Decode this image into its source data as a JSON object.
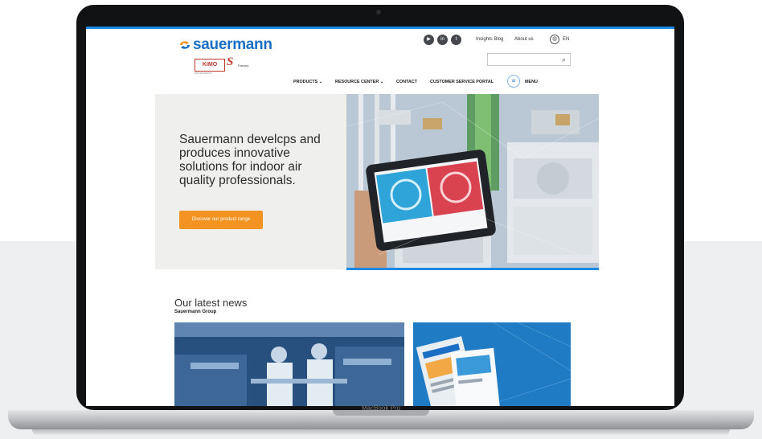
{
  "device": {
    "label": "MacBook Pro"
  },
  "brand": {
    "logo_text": "sauermann",
    "sub_brand_1": "KIMO",
    "sub_brand_1_caption": "INSTRUMENTS",
    "sub_brand_2": "S",
    "sub_brand_2_caption": "Factory",
    "primary_color": "#1a6fc4",
    "accent_color": "#f39322"
  },
  "header": {
    "social": [
      {
        "name": "youtube-icon",
        "glyph": "▶"
      },
      {
        "name": "linkedin-icon",
        "glyph": "in"
      },
      {
        "name": "twitter-icon",
        "glyph": "t"
      }
    ],
    "links": [
      "Insights Blog",
      "About us"
    ],
    "language": "EN",
    "search": {
      "placeholder": "",
      "icon": "search-icon"
    }
  },
  "nav": {
    "items": [
      "PRODUCTS ⌄",
      "RESOURCE CENTER ⌄",
      "CONTACT",
      "CUSTOMER SERVICE PORTAL"
    ],
    "menu_label": "MENU"
  },
  "hero": {
    "title": "Sauermann develcps and produces innovative solutions for indoor air quality professionals.",
    "cta_label": "Discover our product range"
  },
  "news": {
    "heading": "Our latest news",
    "subheading": "Sauermann Group"
  }
}
